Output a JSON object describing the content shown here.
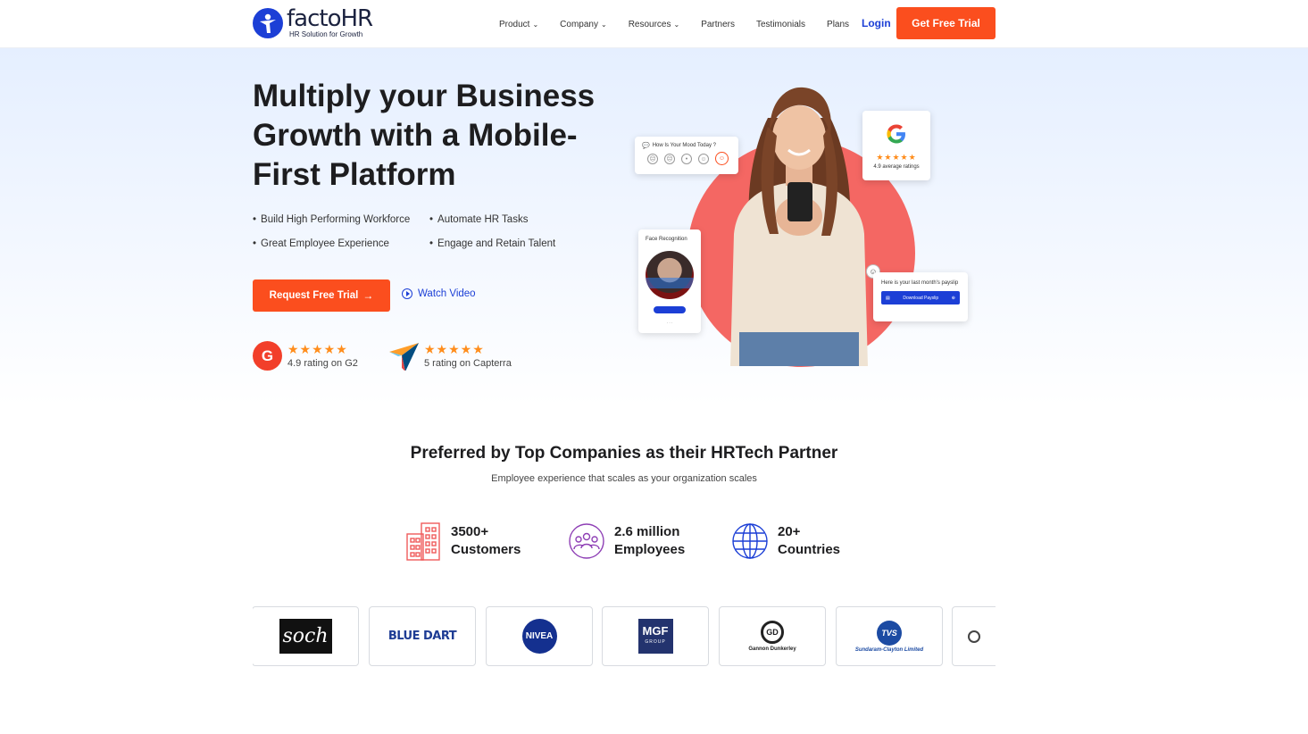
{
  "header": {
    "brand_name": "factoHR",
    "brand_tagline": "HR Solution for Growth",
    "nav": [
      {
        "label": "Product",
        "dropdown": true
      },
      {
        "label": "Company",
        "dropdown": true
      },
      {
        "label": "Resources",
        "dropdown": true
      },
      {
        "label": "Partners",
        "dropdown": false
      },
      {
        "label": "Testimonials",
        "dropdown": false
      },
      {
        "label": "Plans",
        "dropdown": false
      }
    ],
    "login_label": "Login",
    "cta_label": "Get Free Trial"
  },
  "hero": {
    "title": "Multiply your Business Growth with a Mobile-First Platform",
    "bullets": [
      "Build High Performing Workforce",
      "Automate HR Tasks",
      "Great Employee Experience",
      "Engage and Retain Talent"
    ],
    "request_button": "Request Free Trial",
    "watch_video": "Watch Video",
    "ratings": {
      "g2": {
        "stars": "★★★★★",
        "text": "4.9 rating on G2"
      },
      "capterra": {
        "stars": "★★★★★",
        "text": "5 rating on Capterra"
      }
    }
  },
  "hero_cards": {
    "mood_title": "How Is Your Mood Today ?",
    "google_rating_text": "4.9 average ratings",
    "google_stars": "★★★★★",
    "face_title": "Face Recognition",
    "payslip_text": "Here is your last month's payslip",
    "payslip_button": "Download Payslip"
  },
  "partners": {
    "title": "Preferred by Top Companies as their HRTech Partner",
    "subtitle": "Employee experience that scales as your organization scales",
    "stats": [
      {
        "value": "3500+",
        "label": "Customers",
        "icon": "building-icon"
      },
      {
        "value": "2.6 million",
        "label": "Employees",
        "icon": "people-icon"
      },
      {
        "value": "20+",
        "label": "Countries",
        "icon": "globe-icon"
      }
    ],
    "logos": {
      "soch": "soch",
      "bluedart": "BLUE DART",
      "nivea": "NIVEA",
      "mgf": "MGF",
      "mgf_sub": "GROUP",
      "gannon": "Gannon Dunkerley",
      "gannon_mark": "GD",
      "tvs": "TVS",
      "tvs_sub": "Sundaram-Clayton Limited"
    }
  },
  "colors": {
    "accent": "#fb4e1e",
    "brand_blue": "#1c3fd6",
    "star": "#ff8d1c",
    "hero_circle": "#f46763"
  }
}
